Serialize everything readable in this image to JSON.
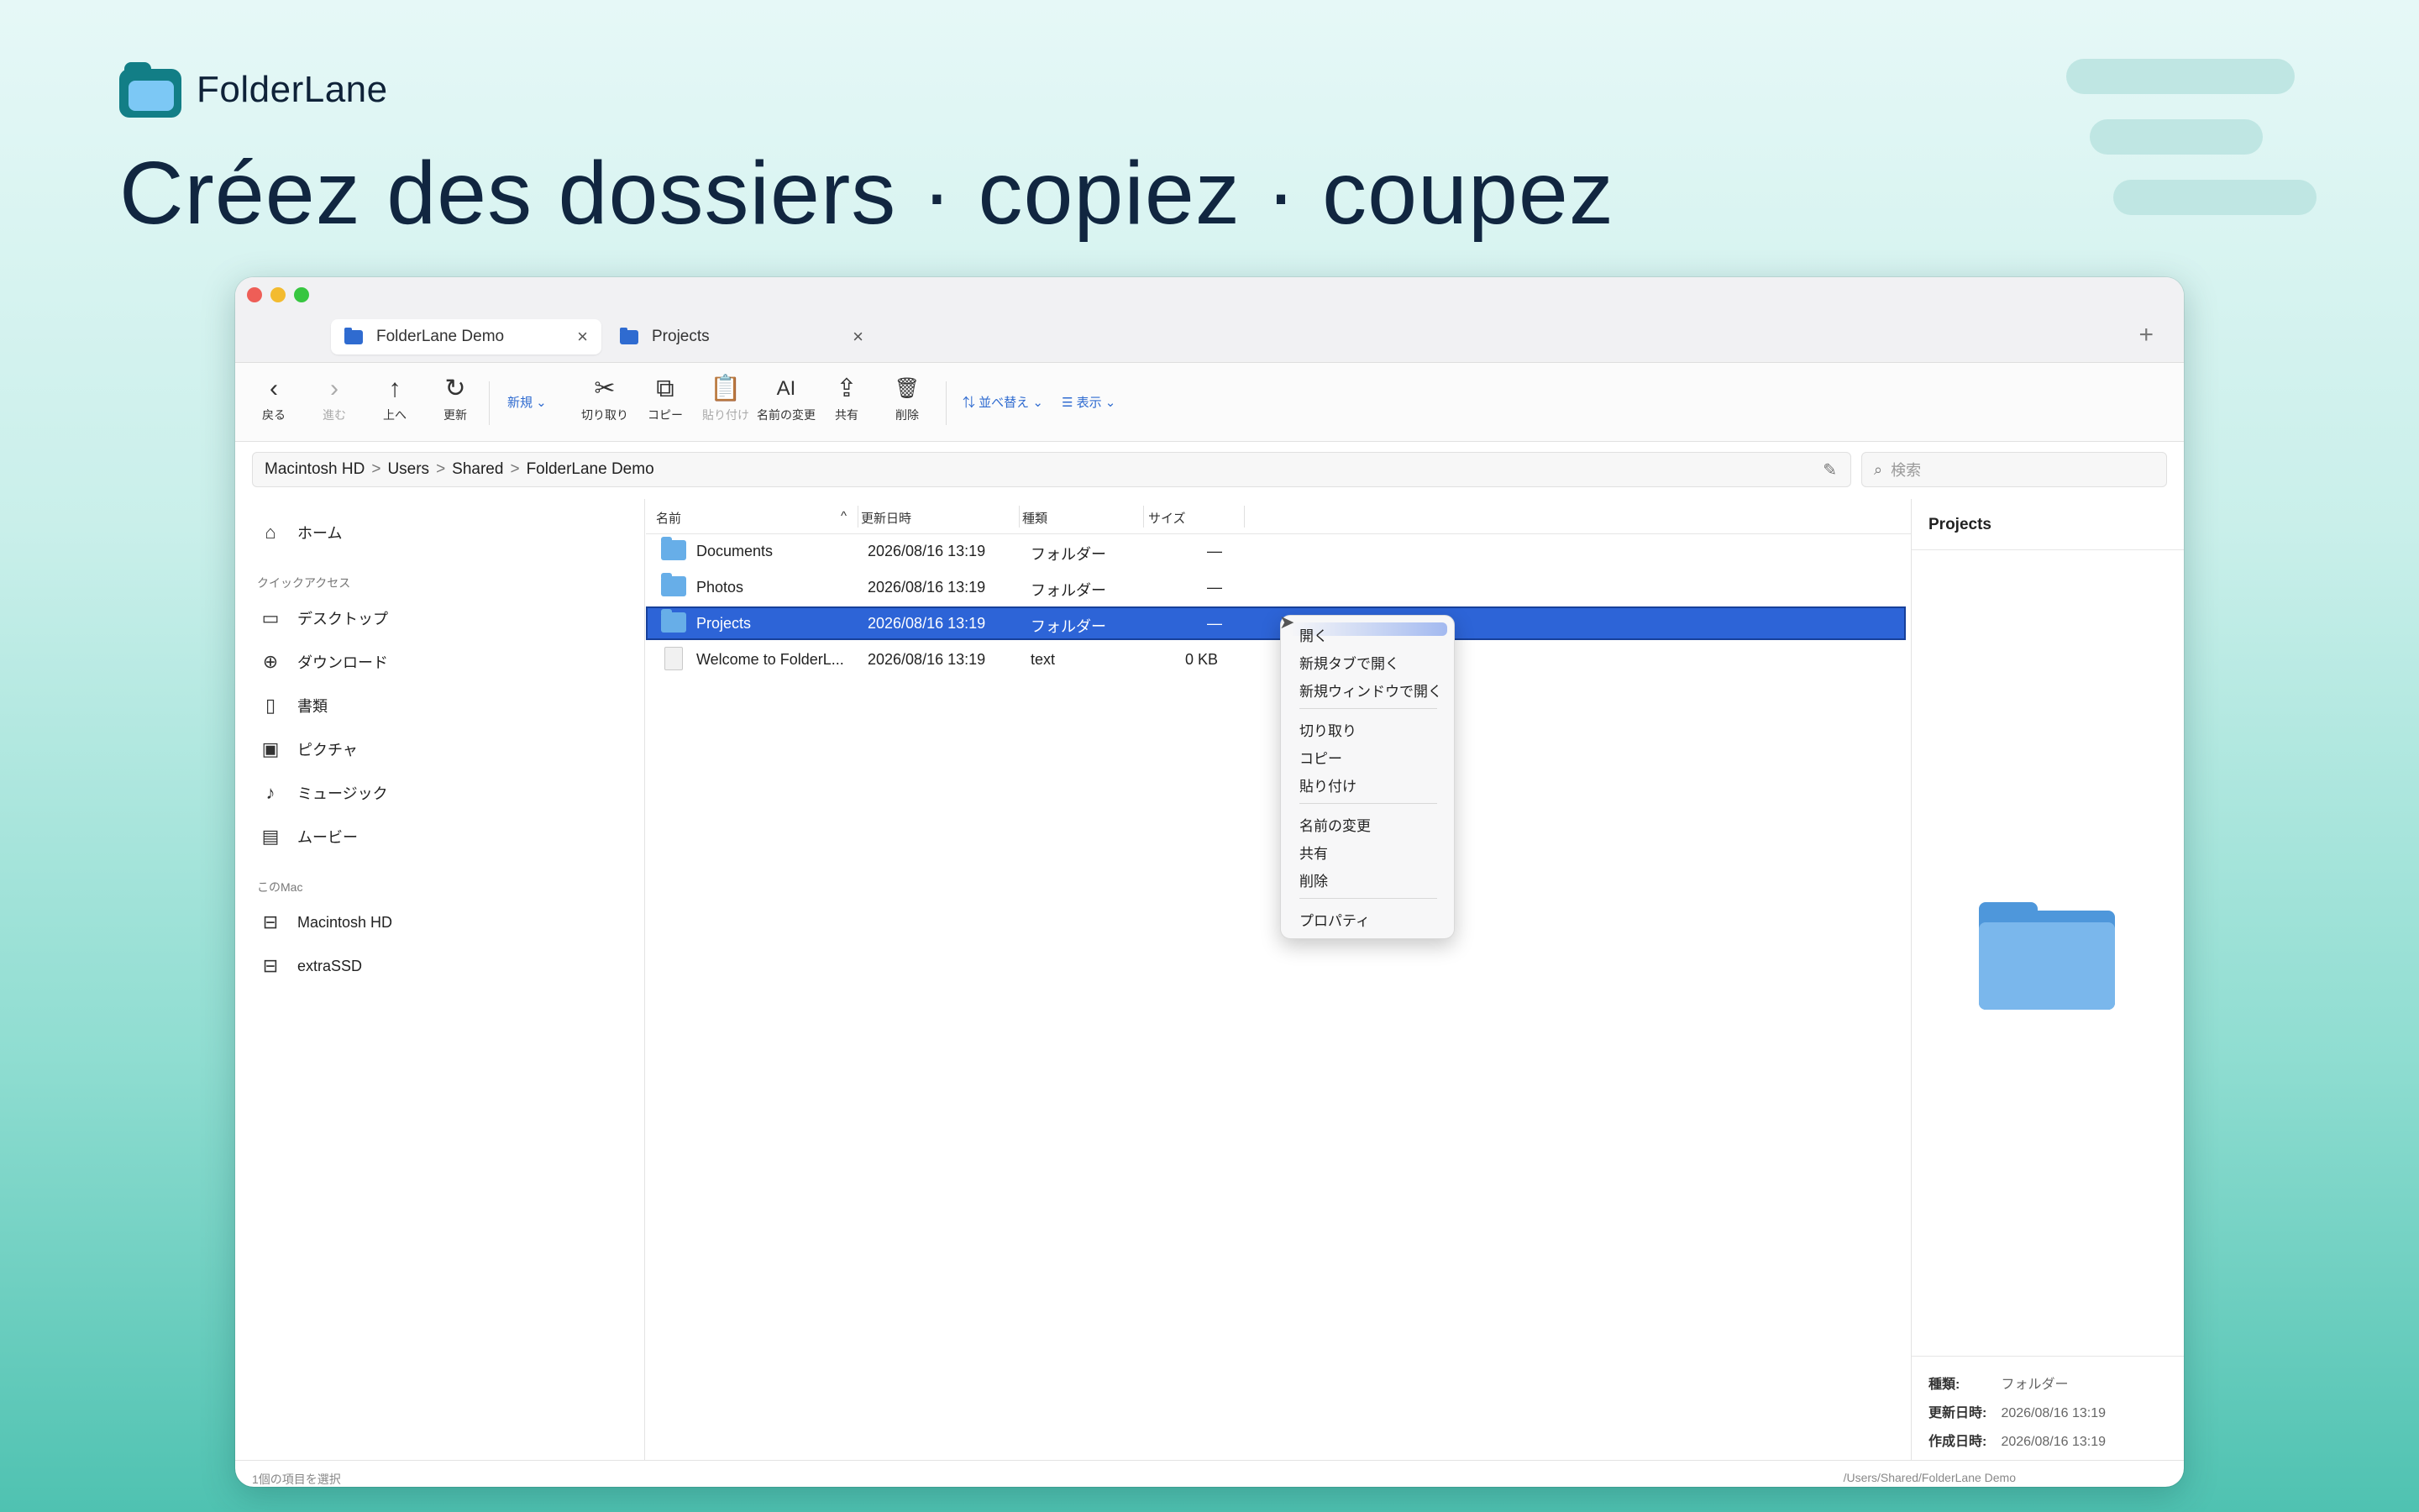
{
  "brand": {
    "name": "FolderLane"
  },
  "headline": "Créez des dossiers · copiez · coupez",
  "window": {
    "tabs": [
      {
        "label": "FolderLane Demo",
        "close": "×"
      },
      {
        "label": "Projects",
        "close": "×"
      }
    ],
    "new_tab": "+",
    "toolbar": {
      "back": {
        "icon": "‹",
        "label": "戻る"
      },
      "forward": {
        "icon": "›",
        "label": "進む"
      },
      "up": {
        "icon": "↑",
        "label": "上へ"
      },
      "refresh": {
        "icon": "↻",
        "label": "更新"
      },
      "new": {
        "label": "新規 ⌄"
      },
      "cut": {
        "icon": "✂",
        "label": "切り取り"
      },
      "copy": {
        "icon": "⧉",
        "label": "コピー"
      },
      "paste": {
        "icon": "📋",
        "label": "貼り付け"
      },
      "rename": {
        "icon": "AI",
        "label": "名前の変更"
      },
      "share": {
        "icon": "⇪",
        "label": "共有"
      },
      "delete": {
        "icon": "🗑",
        "label": "削除"
      },
      "sort": {
        "label": "⇅ 並べ替え ⌄"
      },
      "view": {
        "label": "☰ 表示 ⌄"
      }
    },
    "path": [
      "Macintosh HD",
      "Users",
      "Shared",
      "FolderLane Demo"
    ],
    "path_sep": ">",
    "search_placeholder": "検索",
    "sidebar": {
      "home": "ホーム",
      "quick_access_header": "クイックアクセス",
      "quick_access": [
        "デスクトップ",
        "ダウンロード",
        "書類",
        "ピクチャ",
        "ミュージック",
        "ムービー"
      ],
      "this_mac_header": "このMac",
      "volumes": [
        "Macintosh HD",
        "extraSSD"
      ]
    },
    "columns": {
      "name": "名前",
      "sort_indicator": "^",
      "modified": "更新日時",
      "kind": "種類",
      "size": "サイズ"
    },
    "files": [
      {
        "name": "Documents",
        "modified": "2026/08/16 13:19",
        "kind": "フォルダー",
        "size": "—"
      },
      {
        "name": "Photos",
        "modified": "2026/08/16 13:19",
        "kind": "フォルダー",
        "size": "—"
      },
      {
        "name": "Projects",
        "modified": "2026/08/16 13:19",
        "kind": "フォルダー",
        "size": "—"
      },
      {
        "name": "Welcome to FolderL...",
        "modified": "2026/08/16 13:19",
        "kind": "text",
        "size": "0 KB"
      }
    ],
    "context_menu": {
      "items_1": [
        "開く",
        "新規タブで開く",
        "新規ウィンドウで開く"
      ],
      "items_2": [
        "切り取り",
        "コピー",
        "貼り付け"
      ],
      "items_3": [
        "名前の変更",
        "共有",
        "削除"
      ],
      "items_4": [
        "プロパティ"
      ]
    },
    "inspector": {
      "title": "Projects",
      "kind_label": "種類:",
      "kind_value": "フォルダー",
      "modified_label": "更新日時:",
      "modified_value": "2026/08/16 13:19",
      "created_label": "作成日時:",
      "created_value": "2026/08/16 13:19"
    },
    "status": {
      "left": "1個の項目を選択",
      "right": "/Users/Shared/FolderLane Demo"
    }
  },
  "colors": {
    "accent": "#2d64d7",
    "folder": "#67aee8",
    "brand": "#127e86"
  }
}
